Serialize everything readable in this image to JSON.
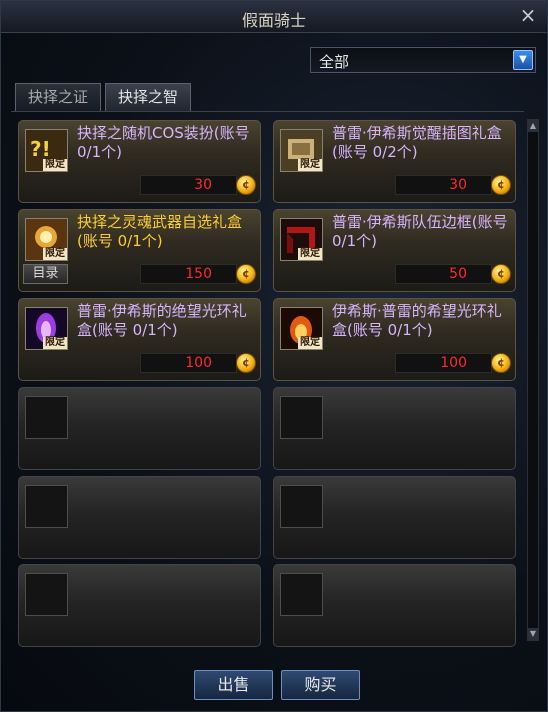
{
  "window": {
    "title": "假面骑士",
    "close_label": "×"
  },
  "filter": {
    "selected": "全部",
    "arrow": "▼"
  },
  "tabs": [
    {
      "label": "抉择之证",
      "active": false
    },
    {
      "label": "抉择之智",
      "active": true
    }
  ],
  "items": [
    {
      "name": "抉择之随机COS装扮(账号 0/1个)",
      "price": "30",
      "limit": "限定",
      "icon": "cos-box-icon"
    },
    {
      "name": "普雷·伊希斯觉醒插图礼盒(账号 0/2个)",
      "price": "30",
      "limit": "限定",
      "icon": "illustration-box-icon"
    },
    {
      "name": "抉择之灵魂武器自选礼盒(账号 0/1个)",
      "price": "150",
      "limit": "限定",
      "icon": "soul-weapon-box-icon",
      "extra_button": "目录"
    },
    {
      "name": "普雷·伊希斯队伍边框(账号 0/1个)",
      "price": "50",
      "limit": "限定",
      "icon": "party-frame-icon"
    },
    {
      "name": "普雷·伊希斯的绝望光环礼盒(账号 0/1个)",
      "price": "100",
      "limit": "限定",
      "icon": "despair-aura-icon"
    },
    {
      "name": "伊希斯·普雷的希望光环礼盒(账号 0/1个)",
      "price": "100",
      "limit": "限定",
      "icon": "hope-aura-icon"
    }
  ],
  "footer": {
    "sell_label": "出售",
    "buy_label": "购买"
  },
  "colors": {
    "item_name_purple": "#d8b3ff",
    "item_name_gold": "#ffcc33",
    "price_red": "#ff2a2a"
  }
}
